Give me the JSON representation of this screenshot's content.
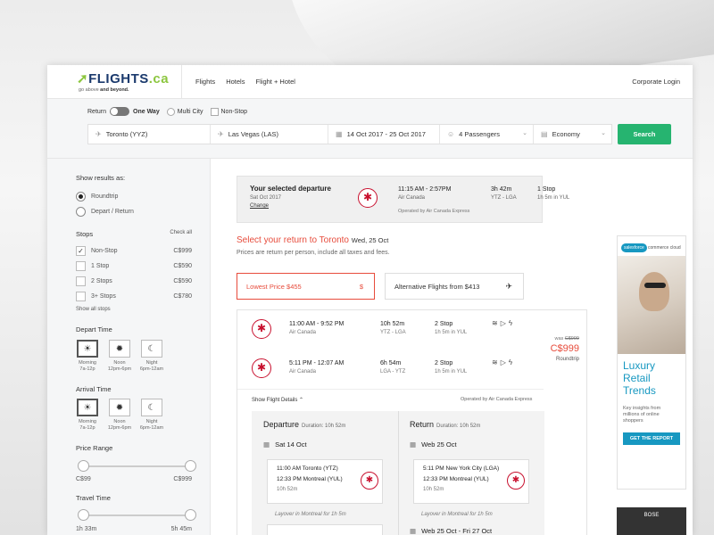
{
  "header": {
    "logo_word": "FLIGHTS",
    "logo_suffix": ".ca",
    "tagline_pre": "go above ",
    "tagline_bold": "and beyond.",
    "nav": [
      "Flights",
      "Hotels",
      "Flight + Hotel"
    ],
    "corporate_login": "Corporate Login"
  },
  "search": {
    "return_label": "Return",
    "one_way_label": "One Way",
    "multi_city_label": "Multi City",
    "non_stop_label": "Non-Stop",
    "from": "Toronto (YYZ)",
    "to": "Las Vegas (LAS)",
    "dates": "14 Oct 2017 - 25 Oct 2017",
    "passengers": "4 Passengers",
    "cabin": "Economy",
    "search_button": "Search"
  },
  "sidebar": {
    "show_results_title": "Show results as:",
    "roundtrip": "Roundtrip",
    "depart_return": "Depart / Return",
    "stops_title": "Stops",
    "check_all": "Check all",
    "stops": [
      {
        "label": "Non-Stop",
        "price": "C$999",
        "checked": true
      },
      {
        "label": "1 Stop",
        "price": "C$590",
        "checked": false
      },
      {
        "label": "2 Stops",
        "price": "C$590",
        "checked": false
      },
      {
        "label": "3+ Stops",
        "price": "C$780",
        "checked": false
      }
    ],
    "show_all_stops": "Show all stops",
    "depart_time_title": "Depart Time",
    "arrival_time_title": "Arrival Time",
    "time_slots": [
      {
        "name": "Morning",
        "range": "7a-12p"
      },
      {
        "name": "Noon",
        "range": "12pm-6pm"
      },
      {
        "name": "Night",
        "range": "6pm-12am"
      }
    ],
    "price_range_title": "Price Range",
    "price_min": "C$99",
    "price_max": "C$999",
    "travel_time_title": "Travel Time",
    "travel_min": "1h 33m",
    "travel_max": "5h 45m"
  },
  "selected_departure": {
    "title": "Your selected departure",
    "date": "Sat Oct 2017",
    "change": "Change",
    "times": "11:15 AM - 2:57PM",
    "airline": "Air Canada",
    "duration": "3h 42m",
    "route": "YTZ - LGA",
    "stops": "1 Stop",
    "stop_detail": "1h 5m in YUL",
    "operated": "Operated by Air Canada Express"
  },
  "return_section": {
    "title": "Select your return to Toronto",
    "date": "Wed, 25 Oct",
    "subtitle": "Prices are return per person, include all taxes and fees.",
    "lowest_price": "Lowest Price $455",
    "lowest_price_symbol": "$",
    "alternative": "Alternative Flights from $413"
  },
  "result": {
    "flights": [
      {
        "times": "11:00 AM - 9:52 PM",
        "airline": "Air Canada",
        "duration": "10h 52m",
        "route": "YTZ - LGA",
        "stops": "2 Stop",
        "stop_detail": "1h 5m in YUL"
      },
      {
        "times": "5:11 PM - 12:07 AM",
        "airline": "Air Canada",
        "duration": "6h 54m",
        "route": "LGA - YTZ",
        "stops": "2 Stop",
        "stop_detail": "1h 5m in YUL"
      }
    ],
    "was_label": "was",
    "was_price": "C$999",
    "price": "C$999",
    "price_type": "Roundtrip",
    "show_details": "Show Flight Details",
    "operated": "Operated by Air Canada Express",
    "departure": {
      "title": "Departure",
      "duration": "Duration: 10h 52m",
      "date": "Sat 14 Oct",
      "leg_from": "11:00 AM Toronto (YTZ)",
      "leg_to": "12:33 PM Montreal (YUL)",
      "leg_duration": "10h 52m",
      "layover": "Layover in Montreal for 1h 5m"
    },
    "return": {
      "title": "Return",
      "duration": "Duration: 10h 52m",
      "date": "Web 25 Oct",
      "leg_from": "5:11 PM New York City (LGA)",
      "leg_to": "12:33 PM Montreal (YUL)",
      "leg_duration": "10h 52m",
      "layover": "Layover in Montreal for 1h 5m",
      "next_date": "Web 25 Oct - Fri 27 Oct"
    }
  },
  "ad": {
    "brand": "salesforce",
    "product": "commerce cloud",
    "headline": [
      "Luxury",
      "Retail",
      "Trends"
    ],
    "body": "Key insights from millions of online shoppers",
    "cta": "GET THE REPORT",
    "second_brand": "BOSE"
  },
  "colors": {
    "accent_green": "#26b470",
    "accent_red": "#e74c3c",
    "airline_red": "#c8102e",
    "brand_navy": "#1b3a6d"
  }
}
